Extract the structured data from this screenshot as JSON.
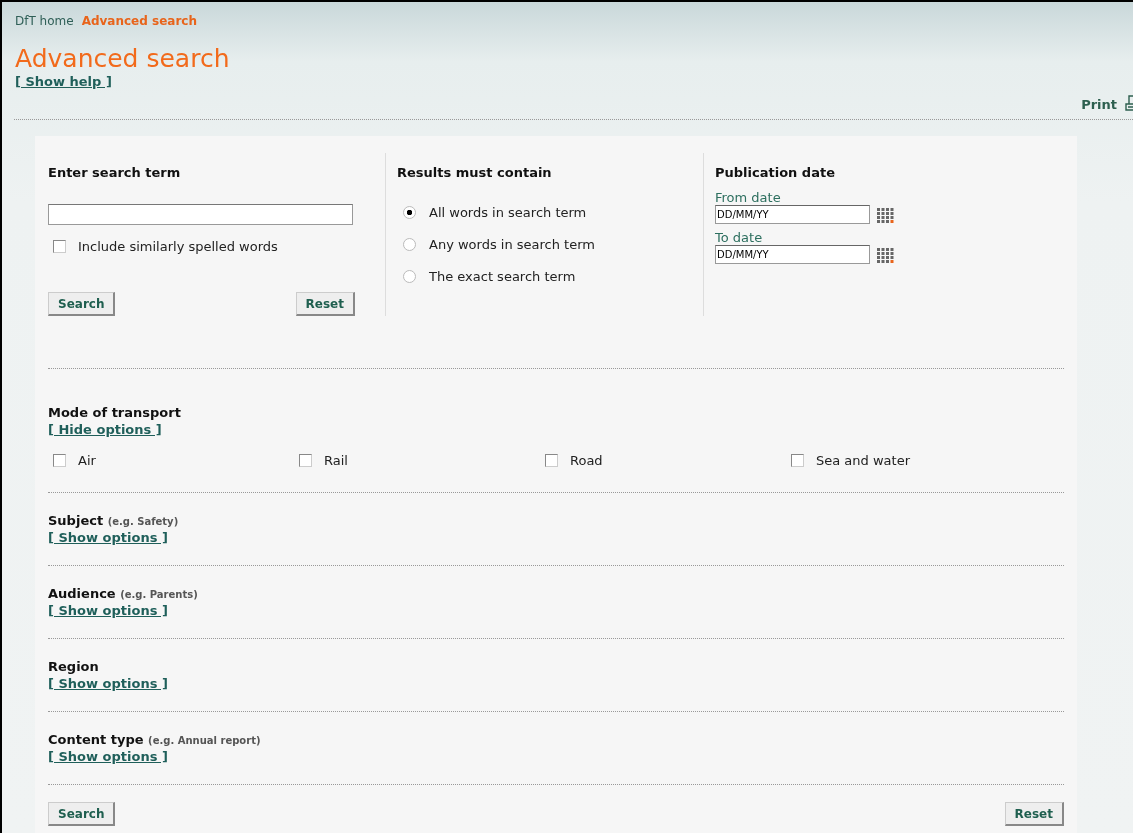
{
  "breadcrumb": [
    {
      "label": "DfT home",
      "current": false
    },
    {
      "label": "Advanced search",
      "current": true
    }
  ],
  "title": "Advanced search",
  "help_link": "[ Show help ]",
  "print_label": "Print",
  "search": {
    "heading": "Enter search term",
    "similar": {
      "label": "Include similarly spelled words",
      "checked": false
    },
    "buttons": [
      "Search",
      "Reset"
    ]
  },
  "match": {
    "heading": "Results must contain",
    "options": [
      {
        "label": "All words in search term",
        "selected": true
      },
      {
        "label": "Any words in search term",
        "selected": false
      },
      {
        "label": "The exact search term",
        "selected": false
      }
    ]
  },
  "date": {
    "heading": "Publication date",
    "fields": [
      {
        "label": "From date",
        "value": "DD/MM/YY"
      },
      {
        "label": "To date",
        "value": "DD/MM/YY"
      }
    ]
  },
  "facets": [
    {
      "title": "Mode of transport",
      "toggle": "[ Hide options ]",
      "expanded": true,
      "options": [
        {
          "label": "Air",
          "checked": false
        },
        {
          "label": "Rail",
          "checked": false
        },
        {
          "label": "Road",
          "checked": false
        },
        {
          "label": "Sea and water",
          "checked": false
        }
      ]
    },
    {
      "title": "Subject",
      "example": "(e.g. Safety)",
      "toggle": "[ Show options ]",
      "expanded": false
    },
    {
      "title": "Audience",
      "example": "(e.g. Parents)",
      "toggle": "[ Show options ]",
      "expanded": false
    },
    {
      "title": "Region",
      "toggle": "[ Show options ]",
      "expanded": false
    },
    {
      "title": "Content type",
      "example": "(e.g. Annual report)",
      "toggle": "[ Show options ]",
      "expanded": false
    }
  ],
  "bottom_buttons": [
    "Search",
    "Reset"
  ]
}
